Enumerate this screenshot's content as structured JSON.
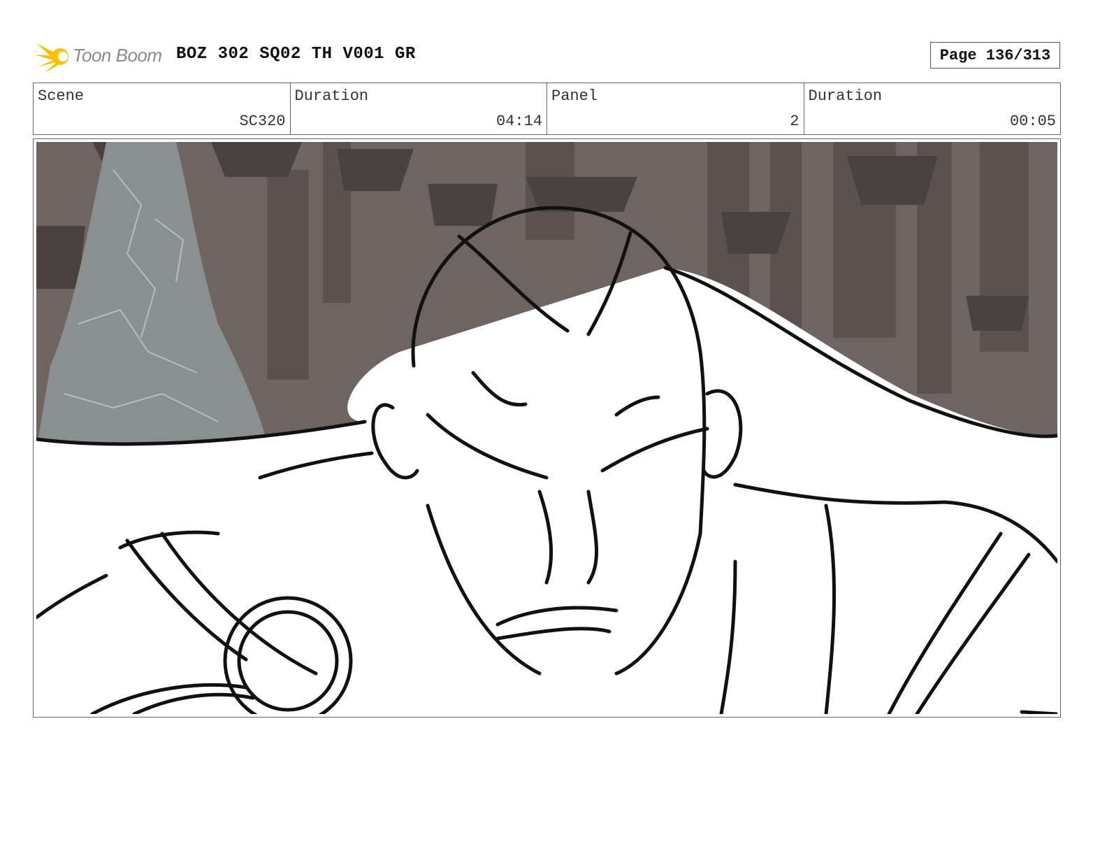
{
  "header": {
    "logo_text": "Toon Boom",
    "doc_title": "BOZ 302 SQ02 TH V001 GR",
    "page_label": "Page 136/313"
  },
  "info": [
    {
      "label": "Scene",
      "value": "SC320"
    },
    {
      "label": "Duration",
      "value": "04:14"
    },
    {
      "label": "Panel",
      "value": "2"
    },
    {
      "label": "Duration",
      "value": "00:05"
    }
  ],
  "colors": {
    "logo_yellow": "#f5c400",
    "background_brown": "#6e6462",
    "rock_gray": "#8a8f90",
    "line_black": "#111111"
  }
}
